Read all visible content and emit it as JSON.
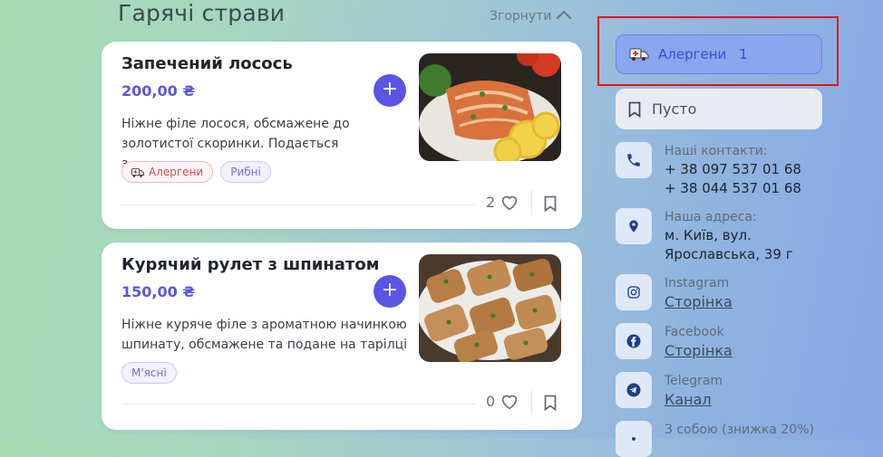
{
  "section": {
    "title": "Гарячі страви",
    "collapse_label": "Згорнути"
  },
  "dishes": [
    {
      "name": "Запечений лосось",
      "price": "200,00 ₴",
      "description_line1": "Ніжне філе лосося, обсмажене до",
      "description_line2": "золотистої скоринки. Подається з...",
      "tags": [
        "Алергени",
        "Рибні"
      ],
      "likes": "2"
    },
    {
      "name": "Курячий рулет з шпинатом",
      "price": "150,00 ₴",
      "description_line1": "Ніжне куряче філе з ароматною начинкою",
      "description_line2": "шпинату, обсмажене та подане на тарілці ...",
      "tags": [
        "М'ясні"
      ],
      "likes": "0"
    }
  ],
  "add_symbol": "+",
  "sidebar": {
    "allergen_button": {
      "label": "Алергени",
      "count": "1"
    },
    "empty_button": {
      "label": "Пусто"
    },
    "contacts": {
      "label": "Наші контакти:",
      "phone1": "+ 38 097 537 01 68",
      "phone2": "+ 38 044 537 01 68"
    },
    "address": {
      "label": "Наша адреса:",
      "line1": "м. Київ, вул.",
      "line2": "Ярославська, 39 г"
    },
    "instagram": {
      "label": "Instagram",
      "link": "Сторінка"
    },
    "facebook": {
      "label": "Facebook",
      "link": "Сторінка"
    },
    "telegram": {
      "label": "Telegram",
      "link": "Канал"
    },
    "takeaway": {
      "label": "З собою (знижка 20%)"
    }
  },
  "colors": {
    "accent": "#5b55e6",
    "allergen_tag": "#d14a5a",
    "category_tag": "#7b6bd6",
    "highlight": "#e3121a"
  }
}
